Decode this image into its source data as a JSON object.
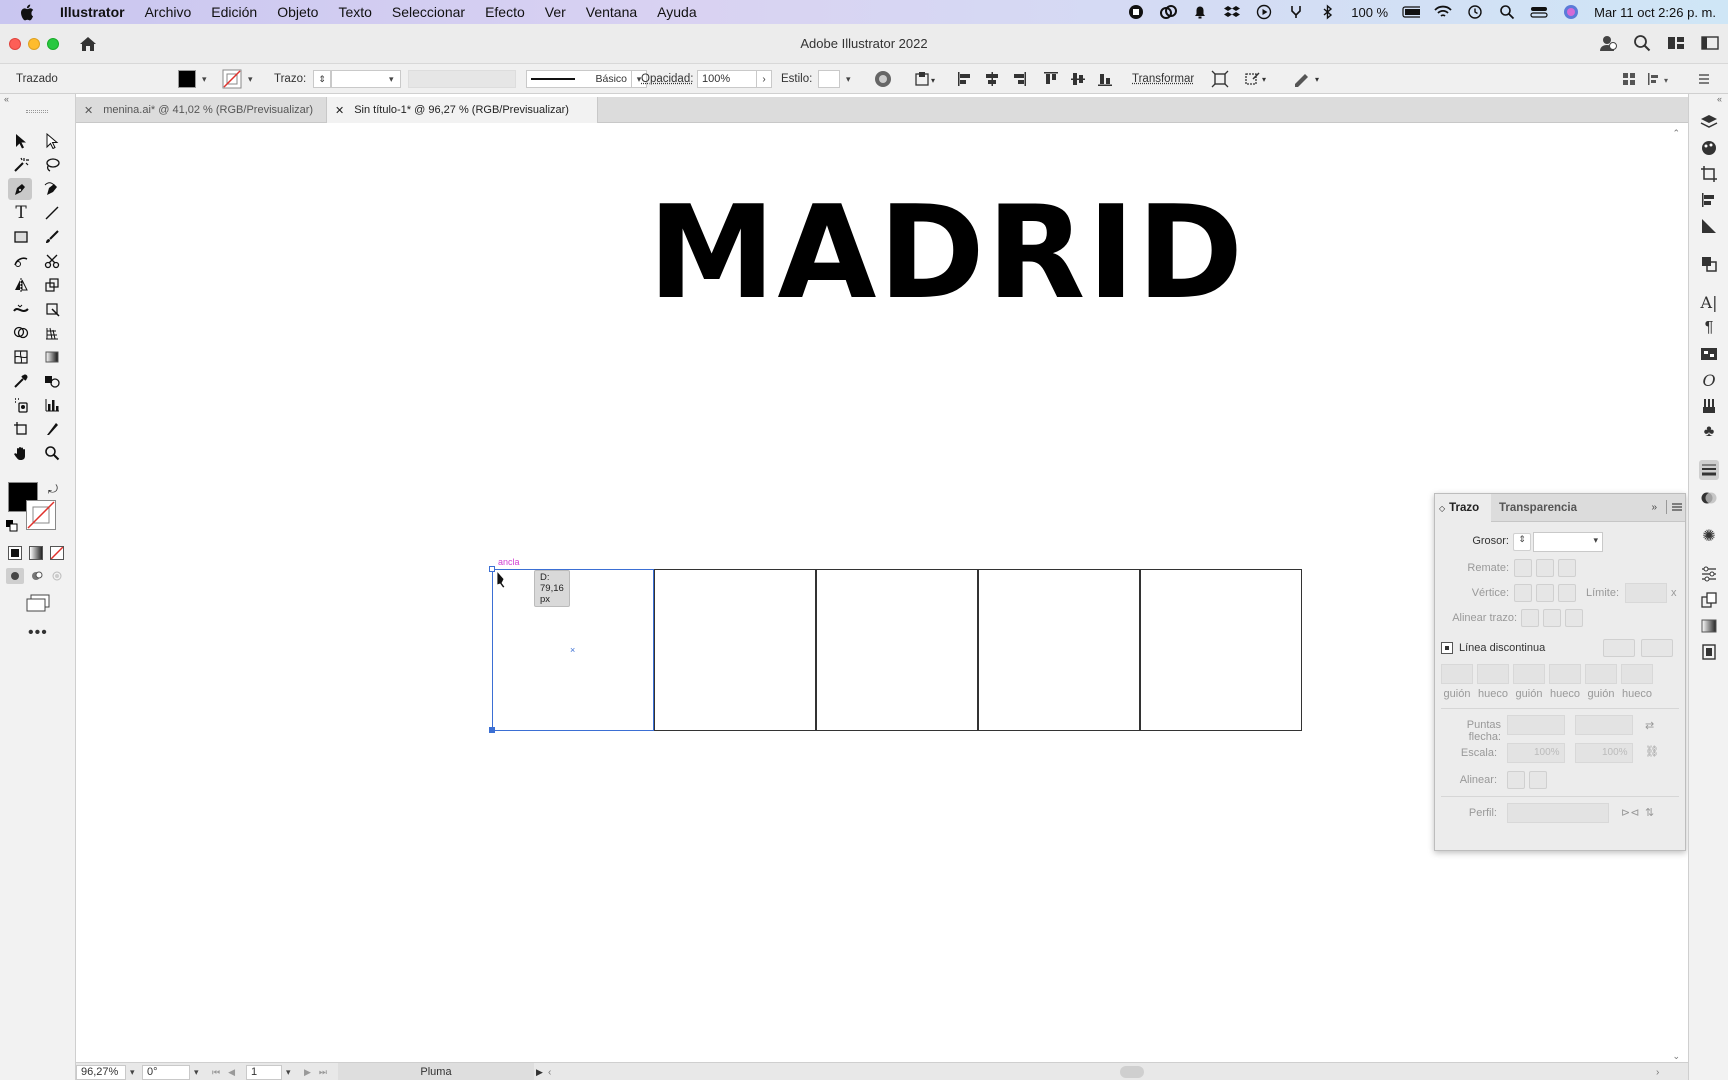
{
  "menubar": {
    "app": "Illustrator",
    "items": [
      "Archivo",
      "Edición",
      "Objeto",
      "Texto",
      "Seleccionar",
      "Efecto",
      "Ver",
      "Ventana",
      "Ayuda"
    ],
    "battery": "100 %",
    "datetime": "Mar 11 oct  2:26 p. m."
  },
  "window": {
    "title": "Adobe Illustrator 2022"
  },
  "control_bar": {
    "selection_type": "Trazado",
    "stroke_label": "Trazo:",
    "brush_label": "Básico",
    "opacity_label": "Opacidad:",
    "opacity_value": "100%",
    "style_label": "Estilo:",
    "transform_label": "Transformar"
  },
  "tabs": [
    {
      "label": "menina.ai* @ 41,02 % (RGB/Previsualizar)",
      "active": false
    },
    {
      "label": "Sin título-1* @ 96,27 % (RGB/Previsualizar)",
      "active": true
    }
  ],
  "artboard": {
    "heading": "MADRID",
    "tooltip": "D: 79,16 px",
    "anchor_hint": "ancla"
  },
  "stroke_panel": {
    "tabs": [
      "Trazo",
      "Transparencia"
    ],
    "weight_label": "Grosor:",
    "cap_label": "Remate:",
    "corner_label": "Vértice:",
    "limit_label": "Límite:",
    "limit_x": "x",
    "align_label": "Alinear trazo:",
    "dashed_label": "Línea discontinua",
    "dash_fields": [
      "guión",
      "hueco",
      "guión",
      "hueco",
      "guión",
      "hueco"
    ],
    "arrowheads_label": "Puntas flecha:",
    "scale_label": "Escala:",
    "scale_values": [
      "100%",
      "100%"
    ],
    "align_arrows_label": "Alinear:",
    "profile_label": "Perfil:"
  },
  "status_bar": {
    "zoom": "96,27%",
    "rotation": "0°",
    "artboard": "1",
    "tool": "Pluma"
  },
  "colors": {
    "accent_selection": "#3b6fd4",
    "fill": "#000000",
    "anchor_hint": "#d23fd2"
  }
}
